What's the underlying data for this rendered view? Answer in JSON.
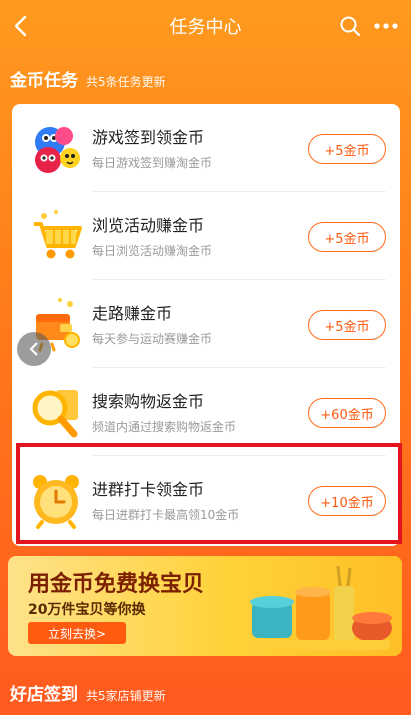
{
  "header": {
    "title": "任务中心"
  },
  "coin_tasks": {
    "title": "金币任务",
    "subtitle": "共5条任务更新",
    "items": [
      {
        "name": "游戏签到领金币",
        "desc": "每日游戏签到赚淘金币",
        "reward": "+5金币",
        "icon": "game-monster-icon"
      },
      {
        "name": "浏览活动赚金币",
        "desc": "每日浏览活动赚淘金币",
        "reward": "+5金币",
        "icon": "shopping-cart-icon"
      },
      {
        "name": "走路赚金币",
        "desc": "每天参与运动赛赚金币",
        "reward": "+5金币",
        "icon": "walking-wallet-icon"
      },
      {
        "name": "搜索购物返金币",
        "desc": "频道内通过搜索购物返金币",
        "reward": "+60金币",
        "icon": "magnifier-icon"
      },
      {
        "name": "进群打卡领金币",
        "desc": "每日进群打卡最高领10金币",
        "reward": "+10金币",
        "icon": "alarm-clock-icon"
      }
    ]
  },
  "banner": {
    "headline": "用金币免费换宝贝",
    "subline": "20万件宝贝等你换",
    "cta": "立刻去换>"
  },
  "good_shops": {
    "title": "好店签到",
    "subtitle": "共5家店铺更新"
  },
  "colors": {
    "accent": "#ff5a0f",
    "highlight_border": "#e4141e"
  }
}
